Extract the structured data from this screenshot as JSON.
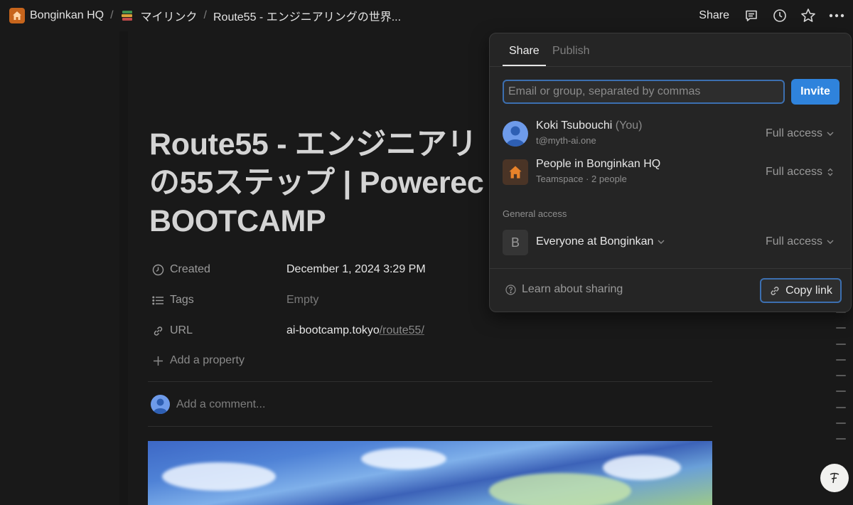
{
  "breadcrumb": {
    "workspace": "Bonginkan HQ",
    "folder": "マイリンク",
    "page": "Route55 - エンジニアリングの世界..."
  },
  "toolbar": {
    "share_label": "Share",
    "icons": [
      "comment-icon",
      "history-icon",
      "star-icon",
      "more-icon"
    ]
  },
  "page": {
    "title": "Route55 - エンジニアリ の55ステップ | Powered BOOTCAMP",
    "title_lines": [
      "Route55 - エンジニアリ",
      "の55ステップ | Powerec",
      "BOOTCAMP"
    ],
    "properties": {
      "created": {
        "label": "Created",
        "value": "December 1, 2024 3:29 PM"
      },
      "tags": {
        "label": "Tags",
        "value": "Empty"
      },
      "url": {
        "label": "URL",
        "value_main": "ai-bootcamp.tokyo",
        "value_path": "/route55/"
      }
    },
    "add_property": "Add a property",
    "comment_placeholder": "Add a comment..."
  },
  "share_popover": {
    "tabs": [
      {
        "label": "Share",
        "active": true
      },
      {
        "label": "Publish",
        "active": false
      }
    ],
    "input_placeholder": "Email or group, separated by commas",
    "invite_label": "Invite",
    "members": [
      {
        "name": "Koki Tsubouchi",
        "you_tag": "(You)",
        "email": "t@myth-ai.one",
        "access": "Full access"
      },
      {
        "name": "People in Bonginkan HQ",
        "sub": "Teamspace · 2 people",
        "access": "Full access"
      }
    ],
    "general_access_label": "General access",
    "general": {
      "letter": "B",
      "name": "Everyone at Bonginkan",
      "access": "Full access"
    },
    "learn_label": "Learn about sharing",
    "copy_link_label": "Copy link"
  },
  "colors": {
    "background": "#191919",
    "accent_blue": "#2f83dc",
    "home_icon_orange": "#c7651c"
  }
}
